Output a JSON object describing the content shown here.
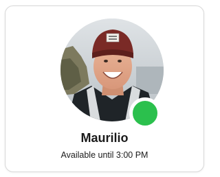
{
  "profile": {
    "name": "Maurilio",
    "availability": "Available until 3:00 PM",
    "status": "online",
    "status_color": "#2bc04d"
  }
}
